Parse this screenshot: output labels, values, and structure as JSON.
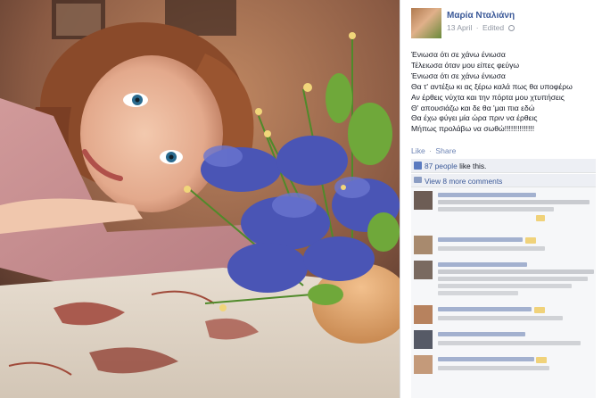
{
  "post": {
    "author": "Μαρία Νταλιάνη",
    "date": "13 April",
    "separator": "·",
    "edited": "Edited",
    "poem_lines": [
      "Ένιωσα ότι σε χάνω ένιωσα",
      "Τέλειωσα όταν μου είπες φεύγω",
      "Ένιωσα ότι σε χάνω ένιωσα",
      "Θα τ' αντέξω κι ας ξέρω καλά πως θα υποφέρω",
      "Αν έρθεις νύχτα και την πόρτα μου χτυπήσεις",
      "Θ' απουσιάζω και δε θα 'μαι πια εδώ",
      "Θα έχω φύγει μία ώρα πριν να έρθεις",
      "Μήπως προλάβω να σωθώ!!!!!!!!!!!!!!"
    ]
  },
  "actions": {
    "like": "Like",
    "dot": "·",
    "share": "Share"
  },
  "likes": {
    "count_text": "87 people",
    "suffix": " like this."
  },
  "comments_link": "View 8 more comments",
  "icons": {
    "like": "thumbs-up-icon",
    "comment": "comment-bubble-icon",
    "privacy": "globe-icon"
  },
  "colors": {
    "link": "#3b5998",
    "secondary": "#9197a3",
    "box_bg": "#edeff4"
  }
}
